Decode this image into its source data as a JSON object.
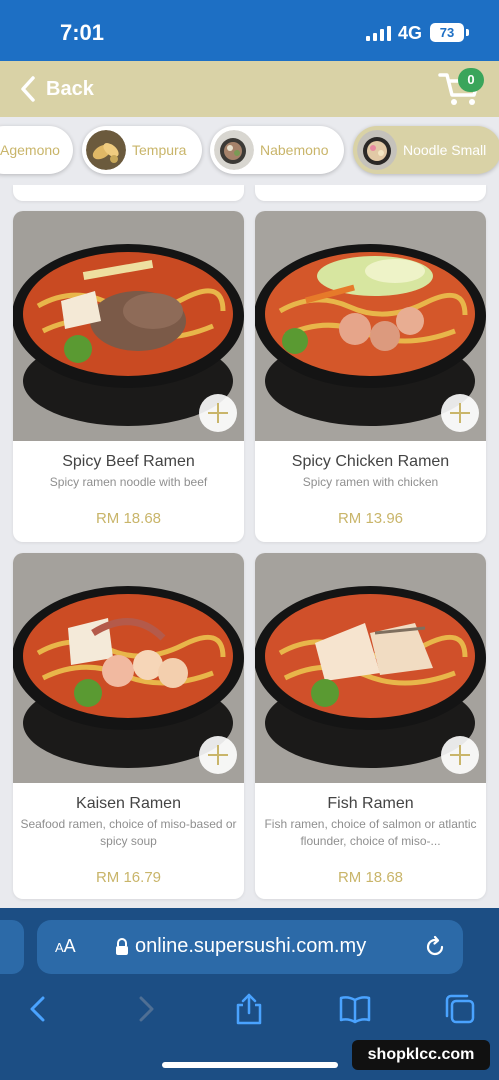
{
  "status_bar": {
    "time": "7:01",
    "network": "4G",
    "battery": "73"
  },
  "header": {
    "back_label": "Back",
    "cart_count": "0",
    "brand_color": "#d9d2a6",
    "cart_badge_color": "#3aa55b"
  },
  "categories": [
    {
      "label": "Agemono",
      "selected": false
    },
    {
      "label": "Tempura",
      "selected": false
    },
    {
      "label": "Nabemono",
      "selected": false
    },
    {
      "label": "Noodle Small",
      "selected": true
    }
  ],
  "menu_items": [
    {
      "name": "Spicy Beef Ramen",
      "description": "Spicy ramen noodle with beef",
      "price": "RM 18.68"
    },
    {
      "name": "Spicy Chicken Ramen",
      "description": "Spicy ramen with chicken",
      "price": "RM 13.96"
    },
    {
      "name": "Kaisen Ramen",
      "description": "Seafood ramen, choice of miso-based or spicy soup",
      "price": "RM 16.79"
    },
    {
      "name": "Fish Ramen",
      "description": "Fish ramen, choice of salmon or atlantic flounder, choice of miso-...",
      "price": "RM 18.68"
    }
  ],
  "browser": {
    "text_size_label": "AA",
    "url": "online.supersushi.com.my"
  },
  "watermark": "shopklcc.com",
  "colors": {
    "price": "#c9b56a",
    "status_bar": "#1d6fc4",
    "browser_bar": "#1c4e84"
  },
  "icons": [
    "signal-icon",
    "back-chevron-icon",
    "cart-icon",
    "add-icon",
    "lock-icon",
    "reload-icon",
    "back-arrow-icon",
    "forward-arrow-icon",
    "share-icon",
    "bookmarks-icon",
    "tabs-icon"
  ]
}
